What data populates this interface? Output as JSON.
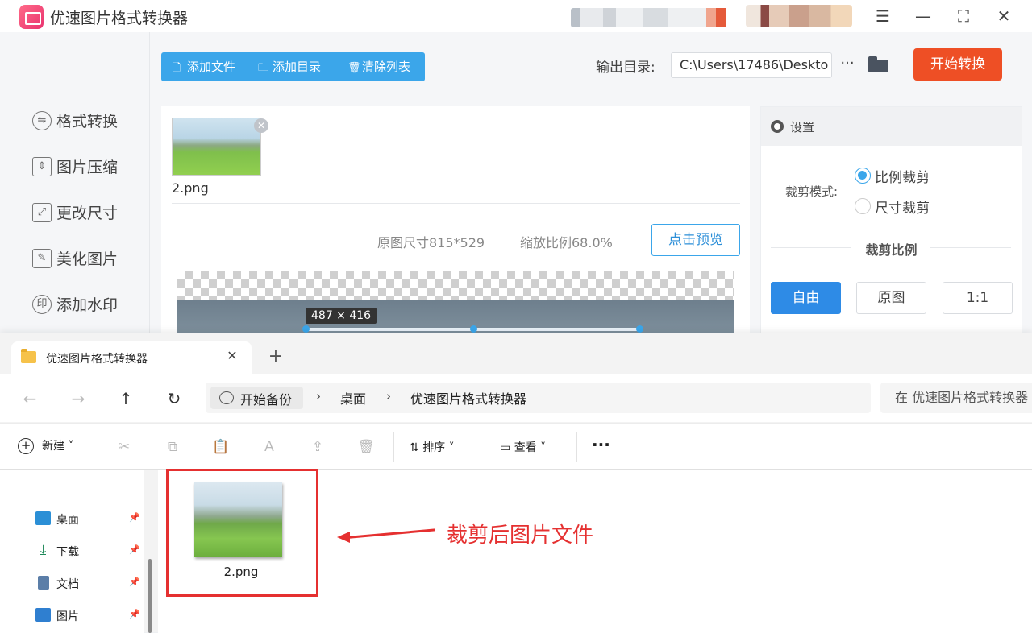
{
  "app": {
    "title": "优速图片格式转换器",
    "window_controls": [
      "menu-icon",
      "minimize-icon",
      "maximize-icon",
      "close-icon"
    ]
  },
  "sidebar": {
    "items": [
      {
        "label": "格式转换",
        "icon": "format-convert-icon"
      },
      {
        "label": "图片压缩",
        "icon": "compress-icon"
      },
      {
        "label": "更改尺寸",
        "icon": "resize-icon"
      },
      {
        "label": "美化图片",
        "icon": "beautify-icon"
      },
      {
        "label": "添加水印",
        "icon": "watermark-icon"
      }
    ]
  },
  "toolbar": {
    "add_file": "添加文件",
    "add_dir": "添加目录",
    "clear_list": "清除列表",
    "output_label": "输出目录:",
    "output_path": "C:\\Users\\17486\\Deskto",
    "more": "···",
    "start": "开始转换"
  },
  "content": {
    "file_name": "2.png",
    "original_size": "原图尺寸815*529",
    "scale": "缩放比例68.0%",
    "preview_button": "点击预览",
    "crop_dimensions": "487 × 416"
  },
  "settings": {
    "title": "设置",
    "crop_mode_label": "裁剪模式:",
    "crop_modes": [
      "比例裁剪",
      "尺寸裁剪"
    ],
    "selected_mode": "比例裁剪",
    "ratio_title": "裁剪比例",
    "ratios": [
      "自由",
      "原图",
      "1:1"
    ],
    "selected_ratio": "自由"
  },
  "explorer": {
    "tab_title": "优速图片格式转换器",
    "breadcrumb": [
      "开始备份",
      "桌面",
      "优速图片格式转换器"
    ],
    "search_placeholder": "在 优速图片格式转换器",
    "new_label": "新建",
    "sort_label": "排序",
    "view_label": "查看",
    "nav_items": [
      "桌面",
      "下载",
      "文档",
      "图片"
    ],
    "file_name": "2.png",
    "annotation": "裁剪后图片文件",
    "colors": {
      "annotation": "#e53030",
      "accent": "#3ba6ea",
      "start_button": "#ee4f25"
    }
  }
}
